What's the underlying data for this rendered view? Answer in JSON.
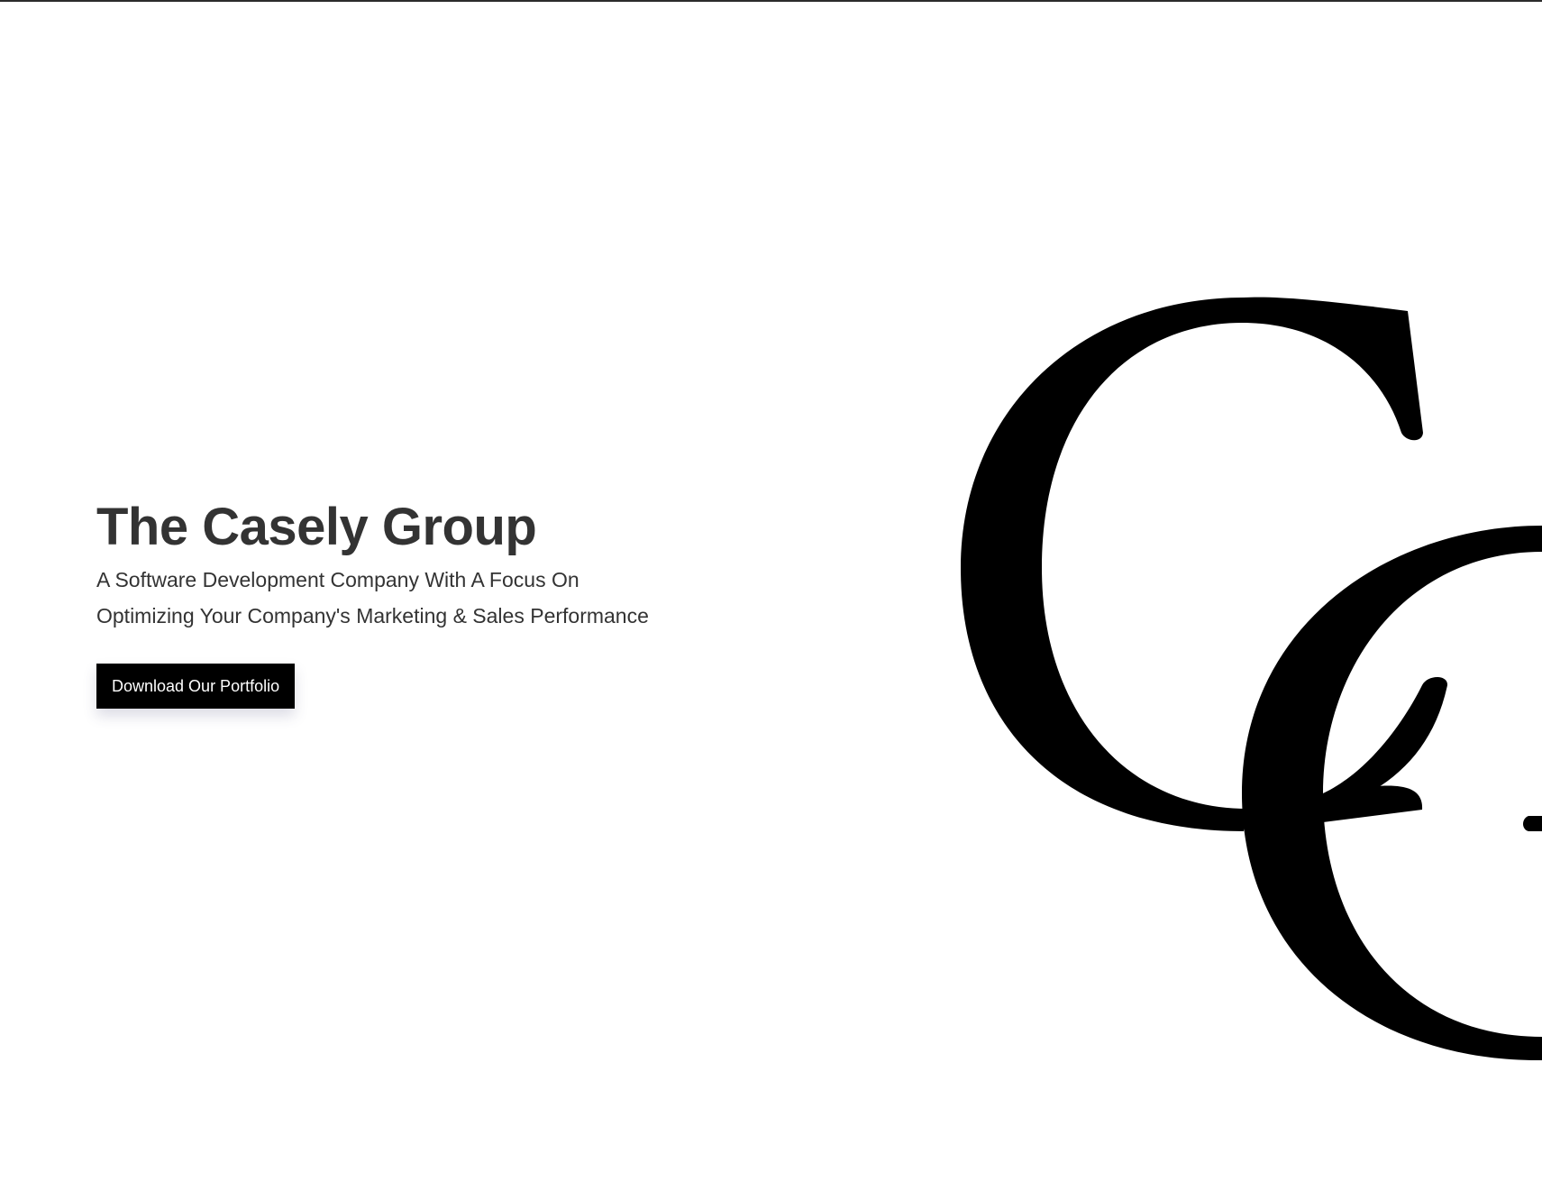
{
  "hero": {
    "title": "The Casely Group",
    "subtitle_line1": "A Software Development Company With A Focus On",
    "subtitle_line2": "Optimizing Your Company's Marketing & Sales Performance",
    "cta_label": "Download Our Portfolio"
  },
  "logo": {
    "icon": "cg-monogram-logo",
    "lettering": "CG"
  },
  "colors": {
    "text": "#333333",
    "button_bg": "#000000",
    "button_text": "#ffffff",
    "logo": "#000000",
    "background": "#ffffff"
  }
}
